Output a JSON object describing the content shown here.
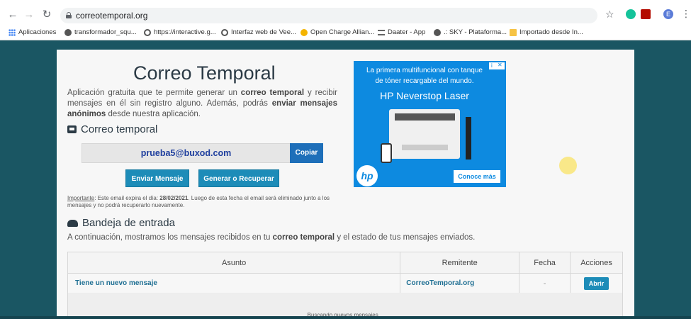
{
  "browser": {
    "url": "correotemporal.org",
    "profile_initial": "E",
    "bookmarks": [
      {
        "label": "Aplicaciones",
        "icon": "apps-icon"
      },
      {
        "label": "transformador_squ...",
        "icon": "chrome-icon"
      },
      {
        "label": "https://interactive.g...",
        "icon": "globe-icon"
      },
      {
        "label": "Interfaz web de Vee...",
        "icon": "globe-icon"
      },
      {
        "label": "Open Charge Allian...",
        "icon": "bookmark-icon"
      },
      {
        "label": "Daater - App",
        "icon": "menu-icon"
      },
      {
        "label": ".: SKY - Plataforma...",
        "icon": "chrome-icon"
      },
      {
        "label": "Importado desde In...",
        "icon": "folder-icon"
      }
    ]
  },
  "header": {
    "title": "Correo Temporal",
    "desc_1": "Aplicación gratuita que te permite generar un ",
    "desc_b1": "correo temporal",
    "desc_2": " y recibir mensajes en él sin registro alguno. Además, podrás ",
    "desc_b2": "enviar mensajes anónimos",
    "desc_3": " desde nuestra aplicación."
  },
  "mailbox": {
    "heading": "Correo temporal",
    "email": "prueba5@buxod.com",
    "copy_label": "Copiar",
    "send_label": "Enviar Mensaje",
    "generate_label": "Generar o Recuperar",
    "note_label": "Importante",
    "note_1": ": Este email expira el día: ",
    "note_date": "28/02/2021",
    "note_2": ". Luego de esta fecha el email será eliminado junto a los mensajes y no podrá recuperarlo nuevamente."
  },
  "inbox": {
    "heading": "Bandeja de entrada",
    "intro_1": "A continuación, mostramos los mensajes recibidos en tu ",
    "intro_b": "correo temporal",
    "intro_2": " y el estado de tus mensajes enviados.",
    "columns": [
      "Asunto",
      "Remitente",
      "Fecha",
      "Acciones"
    ],
    "rows": [
      {
        "subject": "Tiene un nuevo mensaje",
        "sender": "CorreoTemporal.org",
        "date": "-",
        "action": "Abrir"
      }
    ],
    "searching": "Buscando nuevos mensajes..."
  },
  "ad": {
    "line1": "La primera multifuncional con tanque",
    "line2": "de tóner recargable del mundo.",
    "title": "HP Neverstop Laser",
    "cta": "Conoce más",
    "logo": "hp"
  }
}
